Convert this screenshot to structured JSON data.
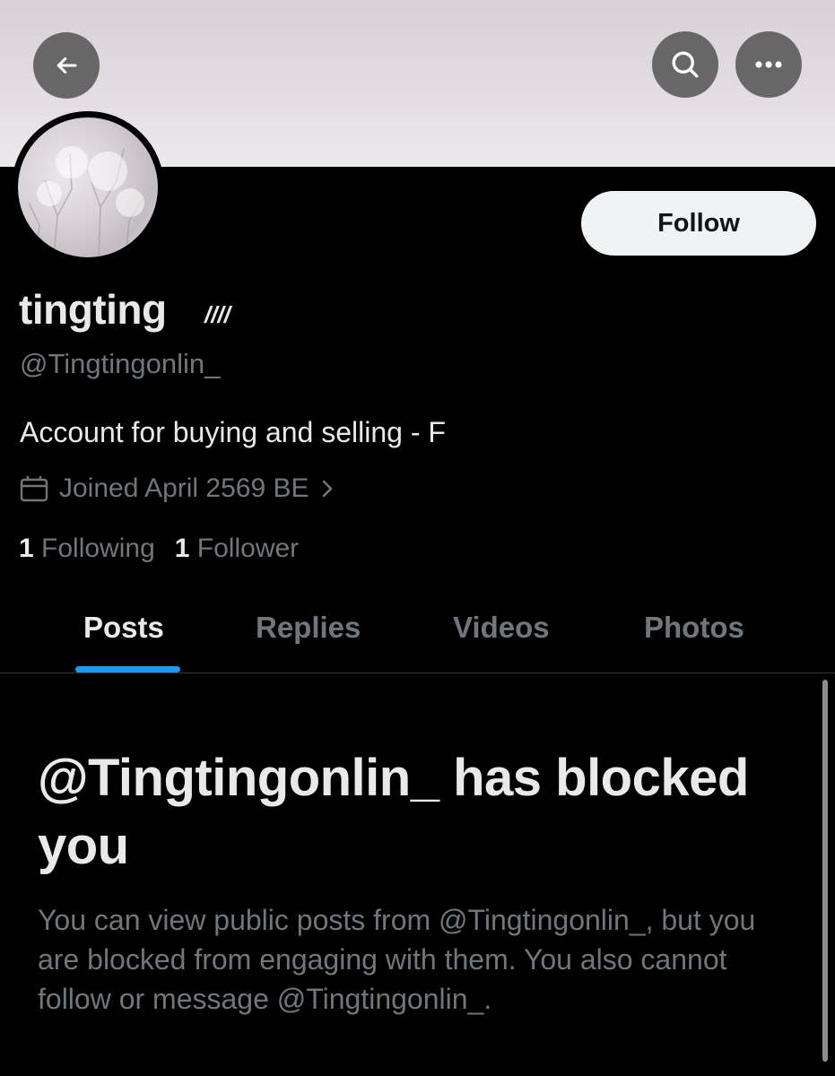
{
  "header": {
    "back_icon": "arrow-left-icon",
    "search_icon": "search-icon",
    "more_icon": "more-horizontal-icon"
  },
  "profile": {
    "display_name": "tingting",
    "name_suffix": "////",
    "handle": "@Tingtingonlin_",
    "bio": "Account for buying and selling - F",
    "joined": "Joined April 2569 BE",
    "following_count": "1",
    "following_label": "Following",
    "followers_count": "1",
    "followers_label": "Follower",
    "follow_button": "Follow"
  },
  "tabs": [
    {
      "label": "Posts",
      "active": true
    },
    {
      "label": "Replies",
      "active": false
    },
    {
      "label": "Videos",
      "active": false
    },
    {
      "label": "Photos",
      "active": false
    }
  ],
  "blocked": {
    "title": "@Tingtingonlin_ has blocked you",
    "description": "You can view public posts from @Tingtingonlin_, but you are blocked from engaging with them. You also cannot follow or message @Tingtingonlin_."
  },
  "colors": {
    "background": "#000000",
    "primary_text": "#e7e9ea",
    "secondary_text": "#71767b",
    "accent": "#1d9bf0",
    "follow_button_bg": "#eff3f4"
  }
}
